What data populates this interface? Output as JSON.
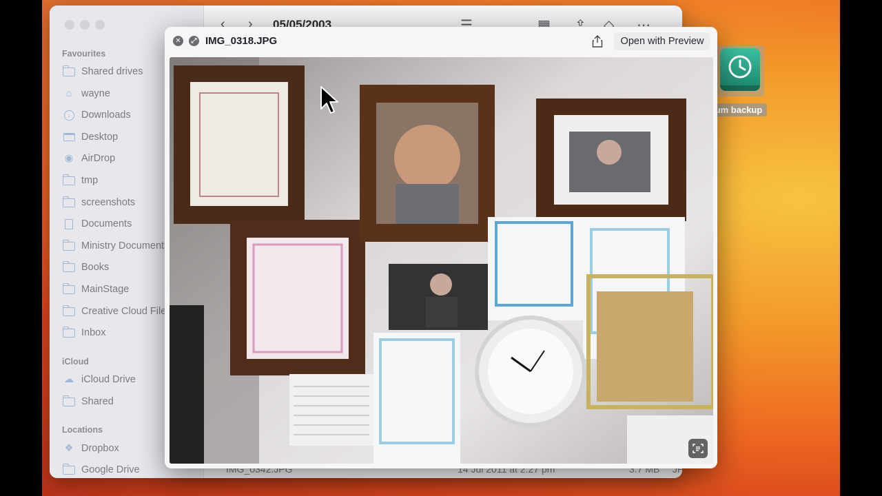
{
  "finder": {
    "folder_title": "05/05/2003",
    "file_row": {
      "name": "IMG_0342.JPG",
      "date": "14 Jul 2011 at 2:27 pm",
      "size": "3.7 MB",
      "kind": "JP"
    },
    "sidebar": {
      "favourites_title": "Favourites",
      "favourites": [
        {
          "label": "Shared drives",
          "icon": "folder-icon"
        },
        {
          "label": "wayne",
          "icon": "home-icon"
        },
        {
          "label": "Downloads",
          "icon": "downloads-icon"
        },
        {
          "label": "Desktop",
          "icon": "desktop-icon"
        },
        {
          "label": "AirDrop",
          "icon": "airdrop-icon"
        },
        {
          "label": "tmp",
          "icon": "folder-icon"
        },
        {
          "label": "screenshots",
          "icon": "folder-icon"
        },
        {
          "label": "Documents",
          "icon": "document-icon"
        },
        {
          "label": "Ministry Documents",
          "icon": "folder-icon"
        },
        {
          "label": "Books",
          "icon": "folder-icon"
        },
        {
          "label": "MainStage",
          "icon": "folder-icon"
        },
        {
          "label": "Creative Cloud Files",
          "icon": "folder-icon"
        },
        {
          "label": "Inbox",
          "icon": "folder-icon"
        }
      ],
      "icloud_title": "iCloud",
      "icloud": [
        {
          "label": "iCloud Drive",
          "icon": "cloud-icon"
        },
        {
          "label": "Shared",
          "icon": "shared-folder-icon"
        }
      ],
      "locations_title": "Locations",
      "locations": [
        {
          "label": "Dropbox",
          "icon": "dropbox-icon"
        },
        {
          "label": "Google Drive",
          "icon": "folder-icon"
        }
      ]
    }
  },
  "desktop": {
    "icon_label": "um backup",
    "icon": "time-machine-icon"
  },
  "quicklook": {
    "filename": "IMG_0318.JPG",
    "open_button_label": "Open with Preview",
    "share_icon": "share-icon",
    "close_icon": "close-icon",
    "fullscreen_icon": "fullscreen-icon",
    "live_text_icon": "live-text-icon"
  },
  "colors": {
    "accent": "#9eb7d4",
    "wallpaper_orange": "#ee6a22",
    "wallpaper_yellow": "#f7c342"
  }
}
